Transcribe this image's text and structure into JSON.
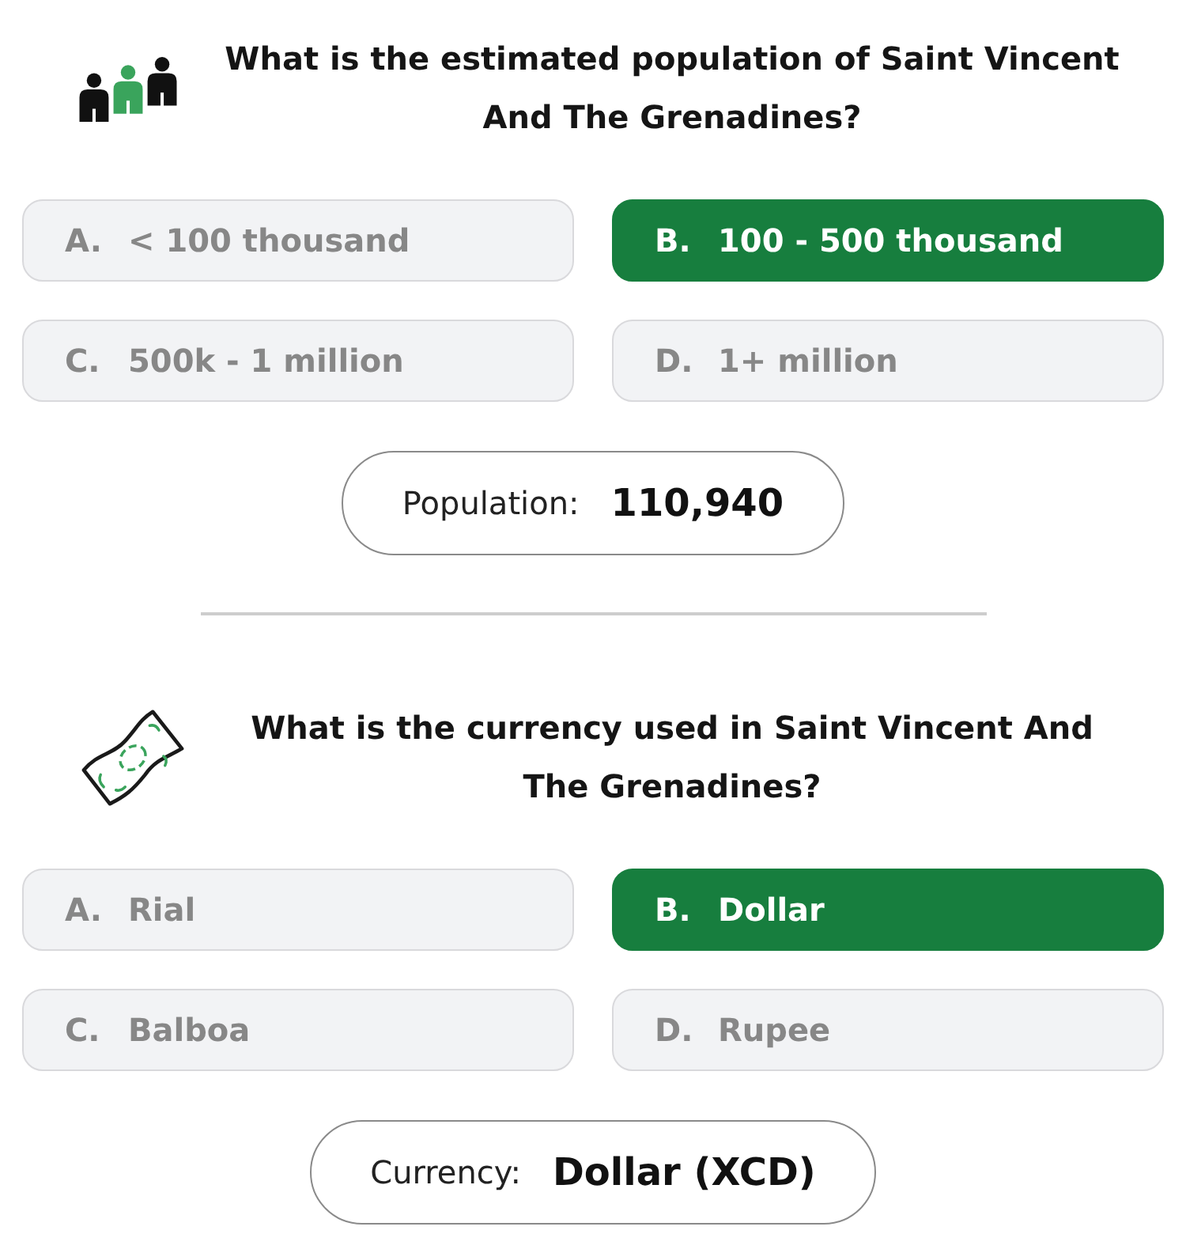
{
  "questions": [
    {
      "kind": "population",
      "question": "What is the estimated population of Saint Vincent And The Grenadines?",
      "options": [
        {
          "letter": "A.",
          "text": "< 100 thousand",
          "selected": false
        },
        {
          "letter": "B.",
          "text": "100 - 500 thousand",
          "selected": true
        },
        {
          "letter": "C.",
          "text": "500k - 1 million",
          "selected": false
        },
        {
          "letter": "D.",
          "text": "1+ million",
          "selected": false
        }
      ],
      "result": {
        "label": "Population:",
        "value": "110,940"
      }
    },
    {
      "kind": "currency",
      "question": "What is the currency used in Saint Vincent And The Grenadines?",
      "options": [
        {
          "letter": "A.",
          "text": "Rial",
          "selected": false
        },
        {
          "letter": "B.",
          "text": "Dollar",
          "selected": true
        },
        {
          "letter": "C.",
          "text": "Balboa",
          "selected": false
        },
        {
          "letter": "D.",
          "text": "Rupee",
          "selected": false
        }
      ],
      "result": {
        "label": "Currency:",
        "value": "Dollar (XCD)"
      }
    }
  ]
}
